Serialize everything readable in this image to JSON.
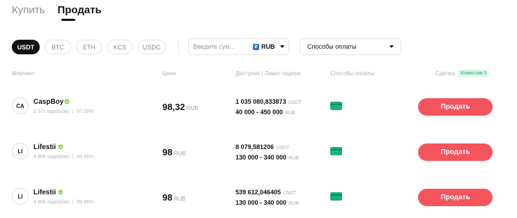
{
  "tabs": [
    {
      "label": "Купить"
    },
    {
      "label": "Продать"
    }
  ],
  "chips": [
    "USDT",
    "BTC",
    "ETH",
    "KCS",
    "USDC"
  ],
  "amount": {
    "placeholder": "Введите сум...",
    "currency_badge": "₽",
    "currency": "RUB"
  },
  "payment_select": {
    "label": "Способы оплаты"
  },
  "headers": {
    "merchant": "Мерчант",
    "price": "Цена",
    "available": "Доступно | Лимит ордера",
    "methods": "Способы оплаты",
    "deal": "Сделка",
    "commission": "Комиссия 0"
  },
  "rows": [
    {
      "initials": "CA",
      "name": "CaspBoy",
      "orders": "2 371 ордер(ов)",
      "rate": "97.09%",
      "price": "98,32",
      "price_unit": "RUB",
      "available": "1 035 080,833873",
      "available_unit": "USDT",
      "limit": "40 000 - 450 000",
      "limit_unit": "RUB",
      "button": "Продать"
    },
    {
      "initials": "LI",
      "name": "Lifestii",
      "orders": "4 809 ордер(ов)",
      "rate": "89.46%",
      "price": "98",
      "price_unit": "RUB",
      "available": "8 079,581206",
      "available_unit": "USDT",
      "limit": "130 000 - 340 000",
      "limit_unit": "RUB",
      "button": "Продать"
    },
    {
      "initials": "LI",
      "name": "Lifestii",
      "orders": "4 809 ордер(ов)",
      "rate": "89.46%",
      "price": "98",
      "price_unit": "RUB",
      "available": "539 612,046405",
      "available_unit": "USDT",
      "limit": "130 000 - 340 000",
      "limit_unit": "RUB",
      "button": "Продать"
    }
  ],
  "colors": {
    "accent_sell": "#f5545c",
    "verified": "#8bd34a",
    "payment_card": "#18b37a"
  }
}
